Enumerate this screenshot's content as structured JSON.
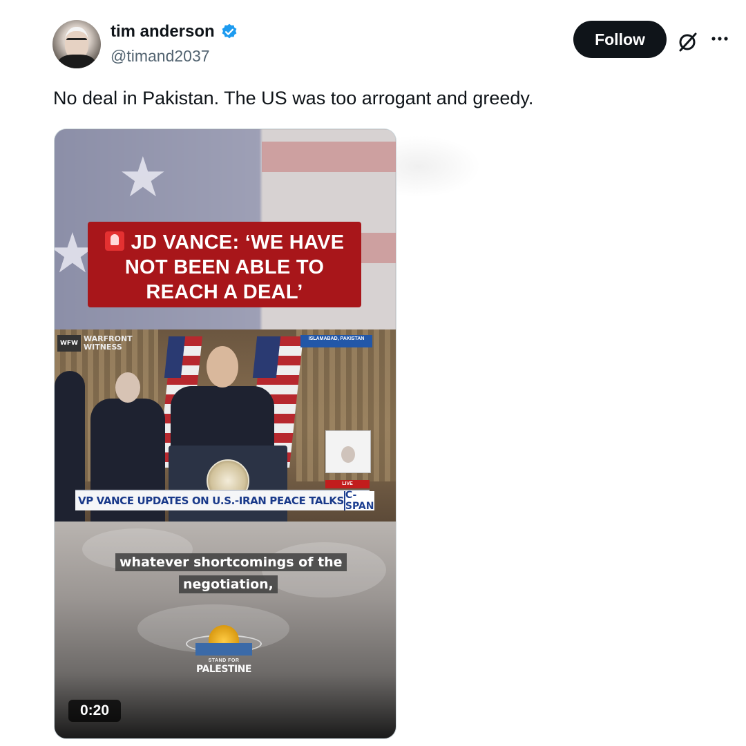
{
  "author": {
    "display_name": "tim anderson",
    "handle": "@timand2037",
    "verified": true
  },
  "actions": {
    "follow_label": "Follow",
    "grok_icon": "grok-icon",
    "more_icon": "more-icon"
  },
  "tweet": {
    "text": "No deal in Pakistan. The US was too arrogant and greedy."
  },
  "media": {
    "headline_icon": "siren-emoji",
    "headline": "JD VANCE: ‘WE HAVE NOT BEEN ABLE TO REACH A DEAL’",
    "watermark_line1": "WARFRONT",
    "watermark_line2": "WITNESS",
    "watermark_abbrev": "WFW",
    "location_tag": "ISLAMABAD, PAKISTAN",
    "live_tag": "LIVE",
    "chyron": "VP VANCE UPDATES ON U.S.-IRAN PEACE TALKS",
    "network": "C-SPAN",
    "caption_line1": "whatever shortcomings of the",
    "caption_line2": "negotiation,",
    "logo_small": "STAND FOR",
    "logo_big": "PALESTINE",
    "duration": "0:20"
  },
  "colors": {
    "verified_blue": "#1d9bf0",
    "headline_red": "#a8161a",
    "follow_bg": "#0f1419"
  }
}
